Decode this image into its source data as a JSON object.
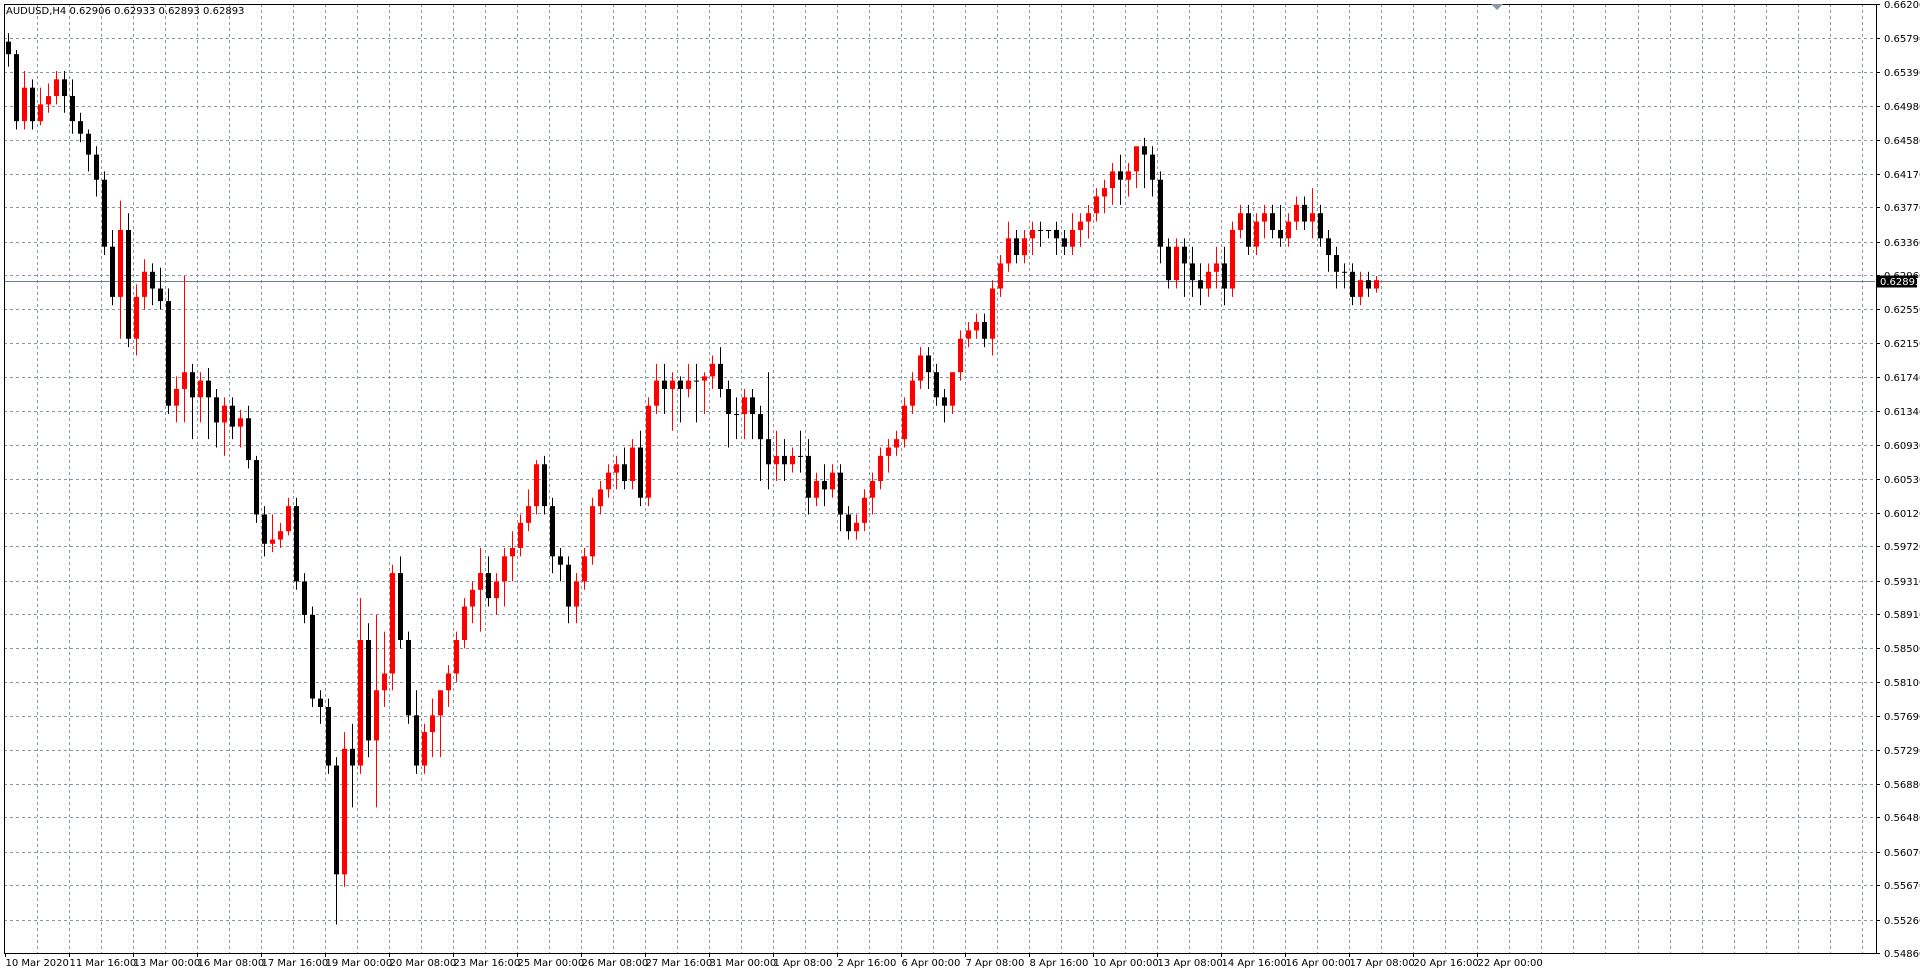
{
  "window": {
    "symbol_line": "AUDUSD,H4  0.62906 0.62933 0.62893 0.62893"
  },
  "colors": {
    "background": "#ffffff",
    "grid": "#8a96a6",
    "axis": "#000000",
    "bull_candle": "#ff0000",
    "bear_candle": "#000000",
    "price_line": "#6e7d98",
    "price_tag_bg": "#000000",
    "price_tag_text": "#ffffff"
  },
  "chart_data": {
    "type": "candlestick",
    "symbol": "AUDUSD",
    "timeframe": "H4",
    "grid": true,
    "ylim": [
      0.5486,
      0.662
    ],
    "current_price": "0.62893",
    "y_ticks": [
      "0.66200",
      "0.65790",
      "0.65390",
      "0.64980",
      "0.64580",
      "0.64170",
      "0.63770",
      "0.63360",
      "0.62960",
      "0.62550",
      "0.62150",
      "0.61740",
      "0.61340",
      "0.60930",
      "0.60530",
      "0.60120",
      "0.59720",
      "0.59310",
      "0.58910",
      "0.58500",
      "0.58100",
      "0.57690",
      "0.57290",
      "0.56880",
      "0.56480",
      "0.56070",
      "0.55670",
      "0.55260",
      "0.54860"
    ],
    "x_ticks": [
      "10 Mar 2020",
      "11 Mar 16:00",
      "13 Mar 00:00",
      "16 Mar 08:00",
      "17 Mar 16:00",
      "19 Mar 00:00",
      "20 Mar 08:00",
      "23 Mar 16:00",
      "25 Mar 00:00",
      "26 Mar 08:00",
      "27 Mar 16:00",
      "31 Mar 00:00",
      "1 Apr 08:00",
      "2 Apr 16:00",
      "6 Apr 00:00",
      "7 Apr 08:00",
      "8 Apr 16:00",
      "10 Apr 00:00",
      "13 Apr 08:00",
      "14 Apr 16:00",
      "16 Apr 00:00",
      "17 Apr 08:00",
      "20 Apr 16:00",
      "22 Apr 00:00"
    ],
    "candles": [
      [
        0.6575,
        0.6585,
        0.656,
        0.6545
      ],
      [
        0.656,
        0.6565,
        0.648,
        0.647
      ],
      [
        0.648,
        0.654,
        0.652,
        0.647
      ],
      [
        0.652,
        0.653,
        0.648,
        0.647
      ],
      [
        0.648,
        0.652,
        0.65,
        0.6475
      ],
      [
        0.65,
        0.6525,
        0.651,
        0.649
      ],
      [
        0.651,
        0.654,
        0.653,
        0.65
      ],
      [
        0.653,
        0.654,
        0.651,
        0.649
      ],
      [
        0.651,
        0.653,
        0.648,
        0.6465
      ],
      [
        0.648,
        0.649,
        0.6465,
        0.6455
      ],
      [
        0.6465,
        0.647,
        0.644,
        0.642
      ],
      [
        0.644,
        0.645,
        0.641,
        0.639
      ],
      [
        0.641,
        0.642,
        0.633,
        0.632
      ],
      [
        0.633,
        0.635,
        0.627,
        0.626
      ],
      [
        0.627,
        0.6385,
        0.635,
        0.622
      ],
      [
        0.635,
        0.637,
        0.622,
        0.621
      ],
      [
        0.622,
        0.6285,
        0.627,
        0.62
      ],
      [
        0.627,
        0.6315,
        0.63,
        0.6255
      ],
      [
        0.63,
        0.631,
        0.628,
        0.626
      ],
      [
        0.628,
        0.6305,
        0.6265,
        0.6255
      ],
      [
        0.6265,
        0.628,
        0.614,
        0.613
      ],
      [
        0.614,
        0.6175,
        0.616,
        0.612
      ],
      [
        0.616,
        0.6295,
        0.618,
        0.612
      ],
      [
        0.618,
        0.619,
        0.615,
        0.61
      ],
      [
        0.615,
        0.618,
        0.617,
        0.612
      ],
      [
        0.617,
        0.6185,
        0.615,
        0.61
      ],
      [
        0.615,
        0.616,
        0.612,
        0.609
      ],
      [
        0.612,
        0.615,
        0.614,
        0.608
      ],
      [
        0.614,
        0.615,
        0.6115,
        0.61
      ],
      [
        0.6115,
        0.6135,
        0.6125,
        0.609
      ],
      [
        0.6125,
        0.614,
        0.6075,
        0.6065
      ],
      [
        0.6075,
        0.608,
        0.601,
        0.6
      ],
      [
        0.601,
        0.602,
        0.5975,
        0.596
      ],
      [
        0.5975,
        0.601,
        0.598,
        0.5965
      ],
      [
        0.598,
        0.6,
        0.599,
        0.597
      ],
      [
        0.599,
        0.603,
        0.602,
        0.5985
      ],
      [
        0.602,
        0.603,
        0.593,
        0.592
      ],
      [
        0.593,
        0.594,
        0.589,
        0.588
      ],
      [
        0.589,
        0.59,
        0.579,
        0.578
      ],
      [
        0.579,
        0.58,
        0.578,
        0.576
      ],
      [
        0.578,
        0.579,
        0.571,
        0.57
      ],
      [
        0.571,
        0.572,
        0.558,
        0.552
      ],
      [
        0.558,
        0.575,
        0.573,
        0.5565
      ],
      [
        0.573,
        0.576,
        0.571,
        0.566
      ],
      [
        0.571,
        0.591,
        0.586,
        0.57
      ],
      [
        0.586,
        0.588,
        0.574,
        0.572
      ],
      [
        0.574,
        0.589,
        0.58,
        0.566
      ],
      [
        0.58,
        0.587,
        0.582,
        0.578
      ],
      [
        0.582,
        0.595,
        0.594,
        0.58
      ],
      [
        0.594,
        0.596,
        0.586,
        0.585
      ],
      [
        0.586,
        0.587,
        0.577,
        0.576
      ],
      [
        0.577,
        0.58,
        0.571,
        0.57
      ],
      [
        0.571,
        0.576,
        0.575,
        0.57
      ],
      [
        0.575,
        0.579,
        0.577,
        0.572
      ],
      [
        0.577,
        0.579,
        0.58,
        0.572
      ],
      [
        0.58,
        0.583,
        0.582,
        0.578
      ],
      [
        0.582,
        0.587,
        0.586,
        0.581
      ],
      [
        0.586,
        0.591,
        0.59,
        0.585
      ],
      [
        0.59,
        0.593,
        0.592,
        0.588
      ],
      [
        0.592,
        0.597,
        0.594,
        0.587
      ],
      [
        0.594,
        0.596,
        0.591,
        0.59
      ],
      [
        0.591,
        0.594,
        0.593,
        0.589
      ],
      [
        0.593,
        0.597,
        0.596,
        0.59
      ],
      [
        0.596,
        0.599,
        0.597,
        0.593
      ],
      [
        0.597,
        0.601,
        0.6,
        0.596
      ],
      [
        0.6,
        0.604,
        0.602,
        0.599
      ],
      [
        0.602,
        0.6075,
        0.607,
        0.601
      ],
      [
        0.607,
        0.608,
        0.602,
        0.601
      ],
      [
        0.602,
        0.603,
        0.596,
        0.594
      ],
      [
        0.596,
        0.597,
        0.595,
        0.593
      ],
      [
        0.595,
        0.596,
        0.59,
        0.588
      ],
      [
        0.59,
        0.594,
        0.593,
        0.588
      ],
      [
        0.593,
        0.597,
        0.596,
        0.592
      ],
      [
        0.596,
        0.603,
        0.602,
        0.595
      ],
      [
        0.602,
        0.605,
        0.604,
        0.601
      ],
      [
        0.604,
        0.607,
        0.606,
        0.603
      ],
      [
        0.606,
        0.608,
        0.607,
        0.604
      ],
      [
        0.607,
        0.609,
        0.605,
        0.604
      ],
      [
        0.605,
        0.61,
        0.609,
        0.604
      ],
      [
        0.609,
        0.611,
        0.603,
        0.602
      ],
      [
        0.603,
        0.615,
        0.614,
        0.602
      ],
      [
        0.614,
        0.619,
        0.617,
        0.613
      ],
      [
        0.617,
        0.619,
        0.616,
        0.613
      ],
      [
        0.616,
        0.618,
        0.617,
        0.611
      ],
      [
        0.617,
        0.6175,
        0.616,
        0.612
      ],
      [
        0.616,
        0.619,
        0.617,
        0.615
      ],
      [
        0.617,
        0.619,
        0.617,
        0.612
      ],
      [
        0.617,
        0.618,
        0.6175,
        0.613
      ],
      [
        0.6175,
        0.62,
        0.619,
        0.616
      ],
      [
        0.619,
        0.621,
        0.616,
        0.615
      ],
      [
        0.616,
        0.617,
        0.613,
        0.609
      ],
      [
        0.613,
        0.615,
        0.613,
        0.61
      ],
      [
        0.613,
        0.616,
        0.615,
        0.61
      ],
      [
        0.615,
        0.616,
        0.613,
        0.61
      ],
      [
        0.613,
        0.614,
        0.61,
        0.605
      ],
      [
        0.61,
        0.618,
        0.607,
        0.604
      ],
      [
        0.607,
        0.611,
        0.608,
        0.605
      ],
      [
        0.608,
        0.61,
        0.607,
        0.605
      ],
      [
        0.607,
        0.609,
        0.608,
        0.606
      ],
      [
        0.608,
        0.611,
        0.608,
        0.606
      ],
      [
        0.608,
        0.61,
        0.603,
        0.601
      ],
      [
        0.603,
        0.606,
        0.605,
        0.602
      ],
      [
        0.605,
        0.607,
        0.604,
        0.602
      ],
      [
        0.604,
        0.607,
        0.606,
        0.603
      ],
      [
        0.606,
        0.607,
        0.601,
        0.599
      ],
      [
        0.601,
        0.602,
        0.599,
        0.598
      ],
      [
        0.599,
        0.601,
        0.6,
        0.598
      ],
      [
        0.6,
        0.604,
        0.603,
        0.599
      ],
      [
        0.603,
        0.606,
        0.605,
        0.601
      ],
      [
        0.605,
        0.609,
        0.608,
        0.604
      ],
      [
        0.608,
        0.61,
        0.609,
        0.606
      ],
      [
        0.609,
        0.611,
        0.61,
        0.608
      ],
      [
        0.61,
        0.615,
        0.614,
        0.609
      ],
      [
        0.614,
        0.618,
        0.617,
        0.613
      ],
      [
        0.617,
        0.621,
        0.62,
        0.616
      ],
      [
        0.62,
        0.621,
        0.618,
        0.616
      ],
      [
        0.618,
        0.619,
        0.615,
        0.614
      ],
      [
        0.615,
        0.616,
        0.614,
        0.612
      ],
      [
        0.614,
        0.618,
        0.618,
        0.613
      ],
      [
        0.618,
        0.623,
        0.622,
        0.617
      ],
      [
        0.622,
        0.624,
        0.623,
        0.621
      ],
      [
        0.623,
        0.625,
        0.624,
        0.622
      ],
      [
        0.624,
        0.625,
        0.622,
        0.621
      ],
      [
        0.622,
        0.629,
        0.628,
        0.62
      ],
      [
        0.628,
        0.632,
        0.631,
        0.627
      ],
      [
        0.631,
        0.636,
        0.634,
        0.63
      ],
      [
        0.634,
        0.635,
        0.632,
        0.631
      ],
      [
        0.632,
        0.635,
        0.634,
        0.631
      ],
      [
        0.634,
        0.636,
        0.635,
        0.632
      ],
      [
        0.635,
        0.636,
        0.635,
        0.633
      ],
      [
        0.635,
        0.635,
        0.635,
        0.634
      ],
      [
        0.635,
        0.636,
        0.634,
        0.632
      ],
      [
        0.634,
        0.635,
        0.633,
        0.632
      ],
      [
        0.633,
        0.637,
        0.635,
        0.632
      ],
      [
        0.635,
        0.637,
        0.636,
        0.633
      ],
      [
        0.636,
        0.638,
        0.637,
        0.634
      ],
      [
        0.637,
        0.64,
        0.639,
        0.636
      ],
      [
        0.639,
        0.641,
        0.64,
        0.637
      ],
      [
        0.64,
        0.643,
        0.642,
        0.638
      ],
      [
        0.642,
        0.644,
        0.641,
        0.638
      ],
      [
        0.641,
        0.643,
        0.642,
        0.639
      ],
      [
        0.642,
        0.644,
        0.645,
        0.64
      ],
      [
        0.645,
        0.646,
        0.644,
        0.64
      ],
      [
        0.644,
        0.645,
        0.641,
        0.639
      ],
      [
        0.641,
        0.642,
        0.633,
        0.631
      ],
      [
        0.633,
        0.634,
        0.629,
        0.628
      ],
      [
        0.629,
        0.634,
        0.633,
        0.628
      ],
      [
        0.633,
        0.634,
        0.631,
        0.627
      ],
      [
        0.631,
        0.633,
        0.629,
        0.627
      ],
      [
        0.629,
        0.631,
        0.628,
        0.626
      ],
      [
        0.628,
        0.631,
        0.63,
        0.627
      ],
      [
        0.63,
        0.633,
        0.631,
        0.628
      ],
      [
        0.631,
        0.633,
        0.628,
        0.626
      ],
      [
        0.628,
        0.636,
        0.635,
        0.627
      ],
      [
        0.635,
        0.638,
        0.637,
        0.634
      ],
      [
        0.637,
        0.638,
        0.633,
        0.632
      ],
      [
        0.633,
        0.637,
        0.636,
        0.632
      ],
      [
        0.636,
        0.638,
        0.637,
        0.634
      ],
      [
        0.637,
        0.638,
        0.635,
        0.634
      ],
      [
        0.635,
        0.638,
        0.634,
        0.633
      ],
      [
        0.634,
        0.637,
        0.636,
        0.633
      ],
      [
        0.636,
        0.639,
        0.638,
        0.635
      ],
      [
        0.638,
        0.639,
        0.636,
        0.635
      ],
      [
        0.636,
        0.64,
        0.637,
        0.634
      ],
      [
        0.637,
        0.638,
        0.634,
        0.633
      ],
      [
        0.634,
        0.635,
        0.632,
        0.63
      ],
      [
        0.632,
        0.633,
        0.63,
        0.628
      ],
      [
        0.63,
        0.631,
        0.63,
        0.628
      ],
      [
        0.63,
        0.631,
        0.627,
        0.626
      ],
      [
        0.627,
        0.63,
        0.629,
        0.626
      ],
      [
        0.629,
        0.63,
        0.628,
        0.627
      ],
      [
        0.628,
        0.6295,
        0.629,
        0.6275
      ]
    ]
  }
}
